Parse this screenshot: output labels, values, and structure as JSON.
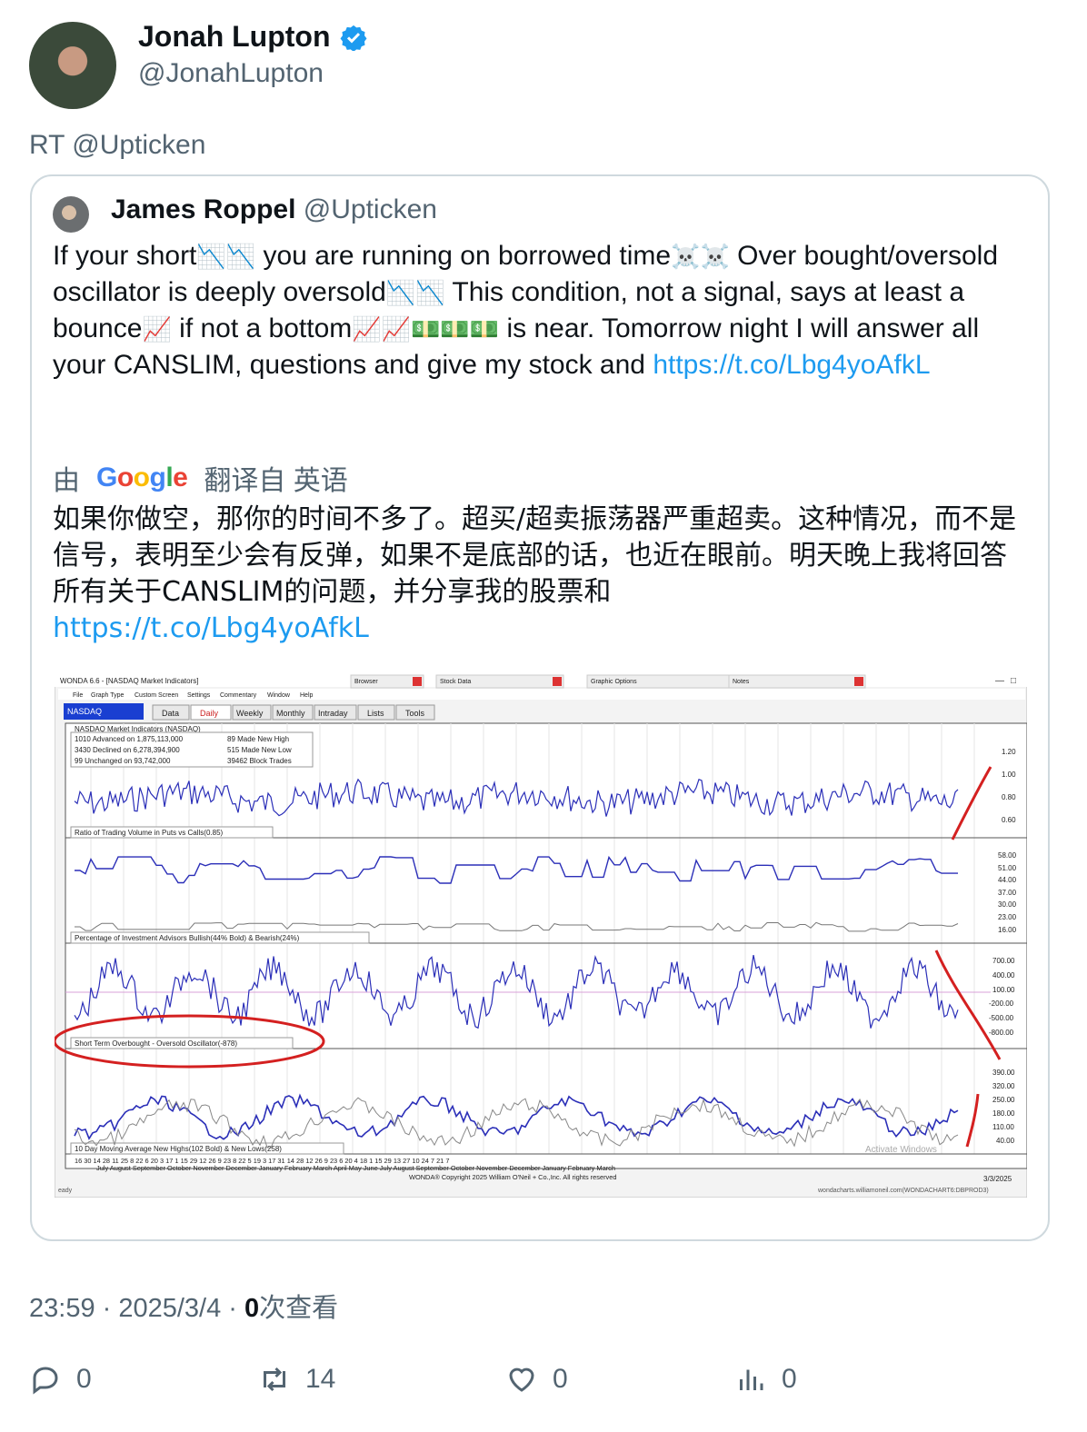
{
  "author": {
    "name": "Jonah Lupton",
    "handle": "@JonahLupton"
  },
  "retweet_label": "RT @Upticken",
  "quoted": {
    "name": "James Roppel",
    "handle": "@Upticken",
    "text_parts": [
      "If your short",
      " you are running on borrowed time",
      " Over bought/oversold oscillator is deeply oversold",
      "  This condition, not a signal, says at least a bounce",
      " if not a bottom",
      " is near. Tomorrow night I will answer all your CANSLIM, questions and give my stock and "
    ],
    "link": "https://t.co/Lbg4yoAfkL",
    "translate_prefix": "由",
    "translate_brand": "Google",
    "translate_suffix": "翻译自 英语",
    "translated_text": "如果你做空，那你的时间不多了。超买/超卖振荡器严重超卖。这种情况，而不是信号，表明至少会有反弹，如果不是底部的话，也近在眼前。明天晚上我将回答所有关于CANSLIM的问题，并分享我的股票和",
    "translated_link": "https://t.co/Lbg4yoAfkL"
  },
  "chart": {
    "window_title": "WONDA 6.6 - [NASDAQ Market Indicators]",
    "menu": [
      "File",
      "Graph Type",
      "Custom Screen",
      "Settings",
      "Commentary",
      "Window",
      "Help"
    ],
    "panels": [
      "Browser",
      "Stock Data",
      "Graphic Options",
      "Notes"
    ],
    "symbol": "NASDAQ",
    "tabs": [
      "Data",
      "Daily",
      "Weekly",
      "Monthly",
      "Intraday",
      "Lists",
      "Tools"
    ],
    "header": "NASDAQ Market Indicators  (NASDAQ)",
    "stats": [
      "1010 Advanced on 1,875,113,000",
      "3430 Declined on 6,278,394,900",
      "99 Unchanged on 93,742,000",
      "89 Made New High",
      "515 Made New Low",
      "39462 Block Trades"
    ],
    "pane_labels": [
      "Ratio of Trading Volume in Puts vs Calls(0.85)",
      "Percentage of Investment Advisors Bullish(44% Bold) & Bearish(24%)",
      "Short Term Overbought - Oversold Oscillator(-878)",
      "10 Day Moving Average New Highs(102 Bold) & New Lows(258)"
    ],
    "axis1": [
      "1.20",
      "1.00",
      "0.80",
      "0.60"
    ],
    "axis2": [
      "58.00",
      "51.00",
      "44.00",
      "37.00",
      "30.00",
      "23.00",
      "16.00"
    ],
    "axis3": [
      "700.00",
      "400.00",
      "100.00",
      "-200.00",
      "-500.00",
      "-800.00"
    ],
    "axis4": [
      "390.00",
      "320.00",
      "250.00",
      "180.00",
      "110.00",
      "40.00"
    ],
    "dates": "16 30 14 28 11 25 8 22 6 20 3 17 1 15 29 12 26 9 23 8 22 5 19 3 17 31 14 28 12 26 9 23 6 20 4 18 1 15 29 13 27 10 24 7 21 7",
    "months": "July   August   September October   November December January   February March   April   May   June   July   August   September October   November December January   February March",
    "copyright": "WONDA® Copyright 2025 William O'Neil + Co.,Inc. All rights reserved",
    "date_stamp": "3/3/2025",
    "status_left": "eady",
    "status_right": "wondacharts.williamoneil.com(WONDACHART6:DBPROD3)",
    "watermark": "Activate Windows"
  },
  "meta": {
    "time": "23:59 · 2025/3/4 · ",
    "views_count": "0",
    "views_label": "次查看"
  },
  "actions": {
    "replies": "0",
    "retweets": "14",
    "likes": "0",
    "views": "0"
  },
  "colors": {
    "link": "#1d9bf0",
    "verified": "#1d9bf0",
    "series": "#2b2fb8",
    "annotation": "#d42020"
  }
}
